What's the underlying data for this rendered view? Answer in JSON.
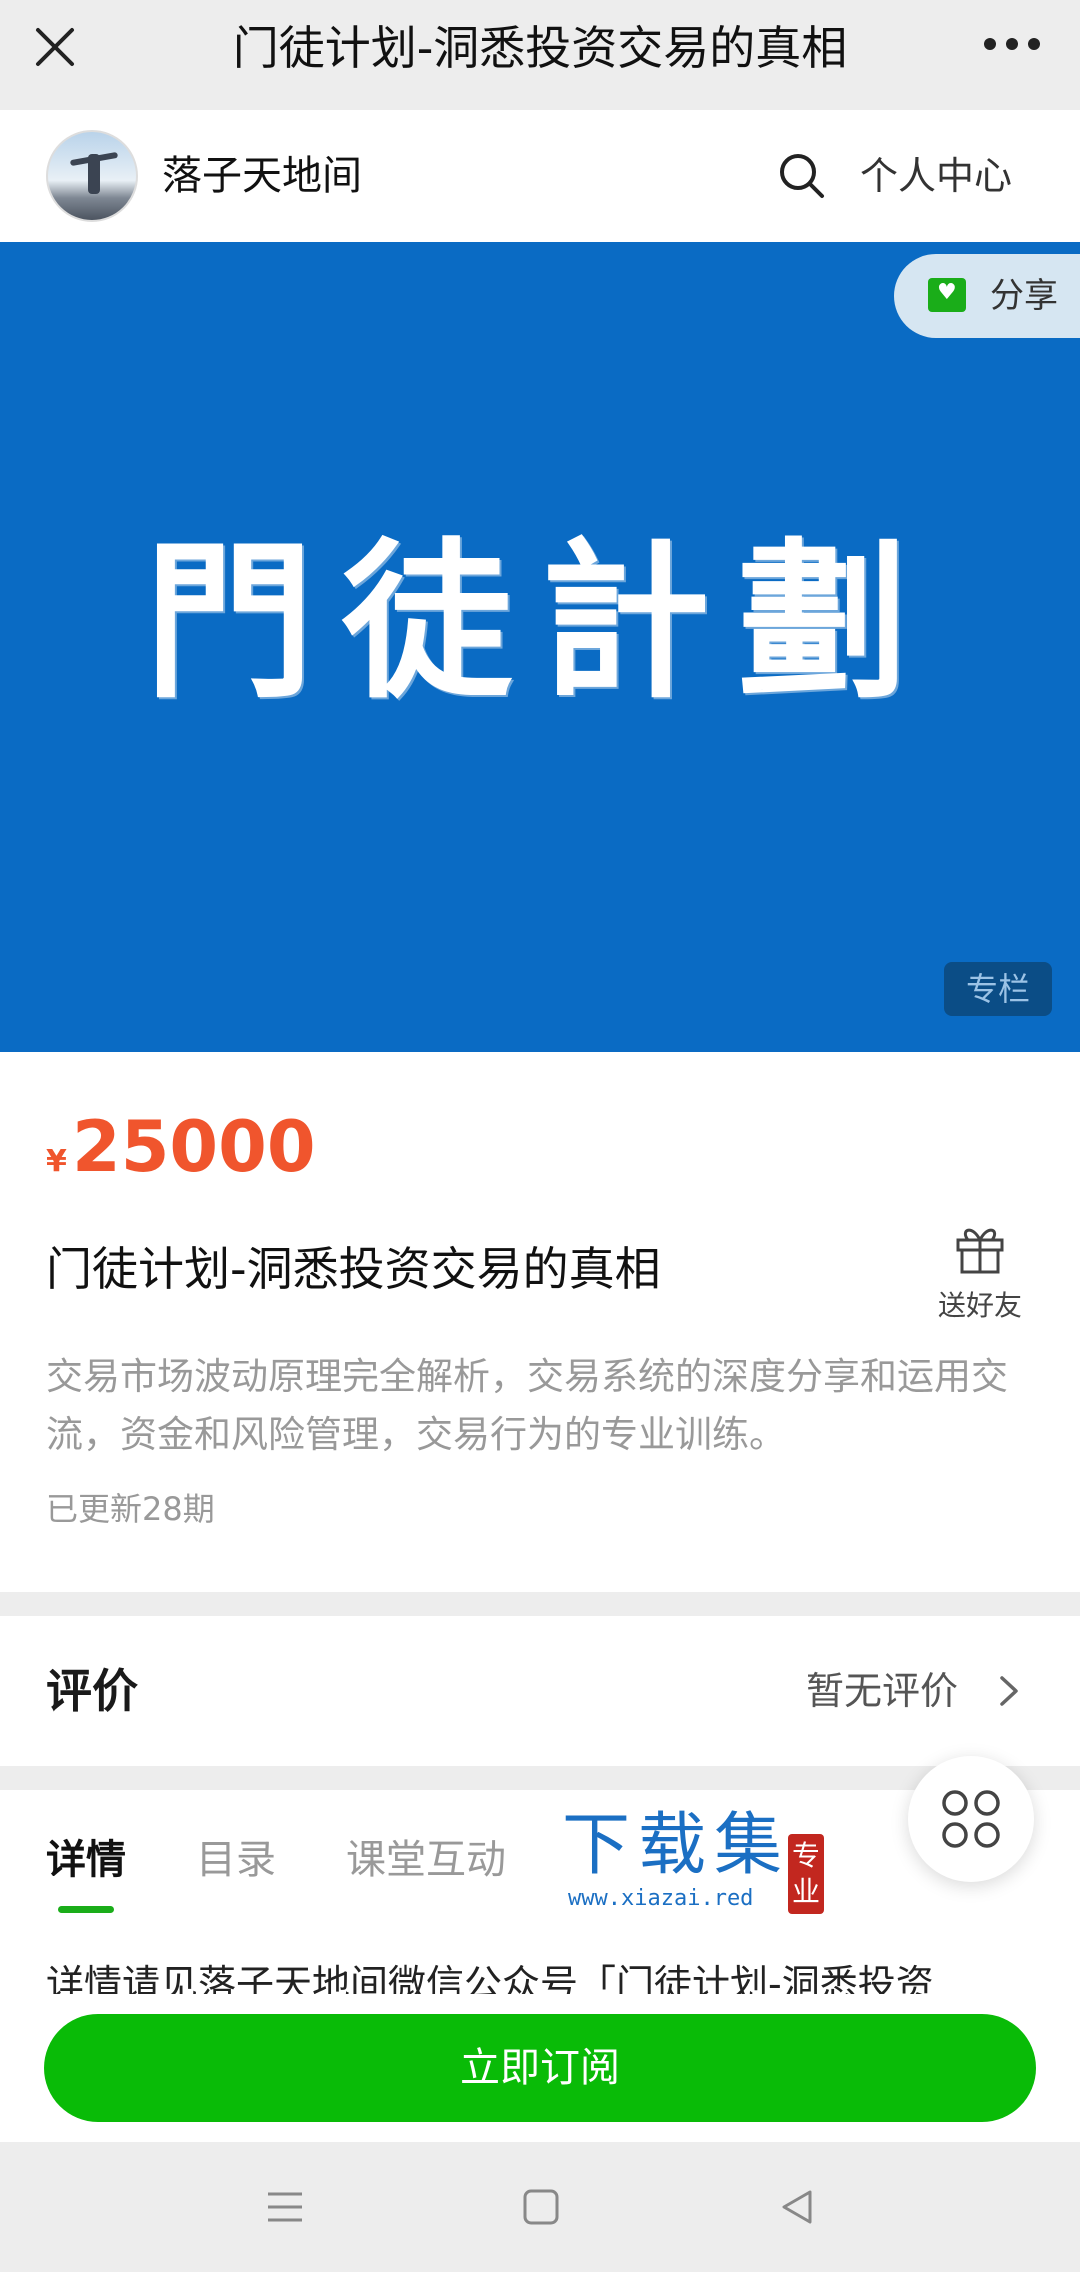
{
  "titlebar": {
    "title": "门徒计划-洞悉投资交易的真相"
  },
  "shop": {
    "name": "落子天地间",
    "center_link": "个人中心"
  },
  "banner": {
    "calligraphy": "門徒計劃",
    "share_label": "分享",
    "tag": "专栏",
    "color": "#0a6bc4"
  },
  "product": {
    "currency": "¥",
    "price": "25000",
    "title": "门徒计划-洞悉投资交易的真相",
    "gift_label": "送好友",
    "description": "交易市场波动原理完全解析，交易系统的深度分享和运用交流，资金和风险管理，交易行为的专业训练。",
    "updated": "已更新28期",
    "price_color": "#f0552d"
  },
  "review": {
    "heading": "评价",
    "status": "暂无评价"
  },
  "tabs": [
    {
      "label": "详情"
    },
    {
      "label": "目录"
    },
    {
      "label": "课堂互动"
    }
  ],
  "watermark": {
    "text": "下载集",
    "url": "www.xiazai.red",
    "seal": "专业"
  },
  "detail": {
    "text": "详情请见落子天地间微信公众号「门徒计划-洞悉投资"
  },
  "subscribe": {
    "label": "立即订阅",
    "color": "#09bb07"
  },
  "icons": [
    "close-icon",
    "more-icon",
    "search-icon",
    "share-icon",
    "gift-icon",
    "chevron-right-icon",
    "apps-icon",
    "menu-icon",
    "home-icon",
    "back-icon"
  ]
}
